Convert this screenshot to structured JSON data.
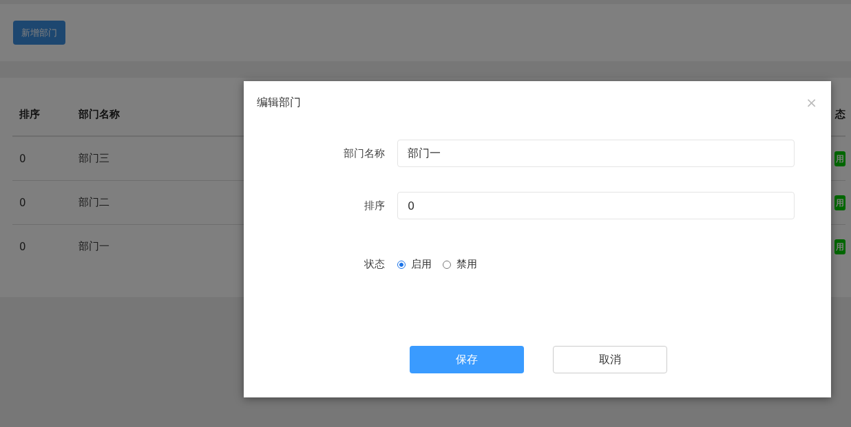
{
  "toolbar": {
    "add_button": "新增部门"
  },
  "table": {
    "columns": [
      "排序",
      "部门名称",
      "态"
    ],
    "rows": [
      {
        "order": "0",
        "name": "部门三",
        "status": "用"
      },
      {
        "order": "0",
        "name": "部门二",
        "status": "用"
      },
      {
        "order": "0",
        "name": "部门一",
        "status": "用"
      }
    ]
  },
  "dialog": {
    "title": "编辑部门",
    "close": "×",
    "fields": [
      {
        "kind": "text",
        "label": "部门名称",
        "value": "部门一"
      },
      {
        "kind": "text",
        "label": "排序",
        "value": "0"
      },
      {
        "kind": "radio",
        "label": "状态",
        "options": [
          {
            "label": "启用",
            "selected": true
          },
          {
            "label": "禁用",
            "selected": false
          }
        ]
      }
    ],
    "buttons": [
      {
        "label": "保存",
        "kind": "primary"
      },
      {
        "label": "取消",
        "kind": "default"
      }
    ]
  }
}
